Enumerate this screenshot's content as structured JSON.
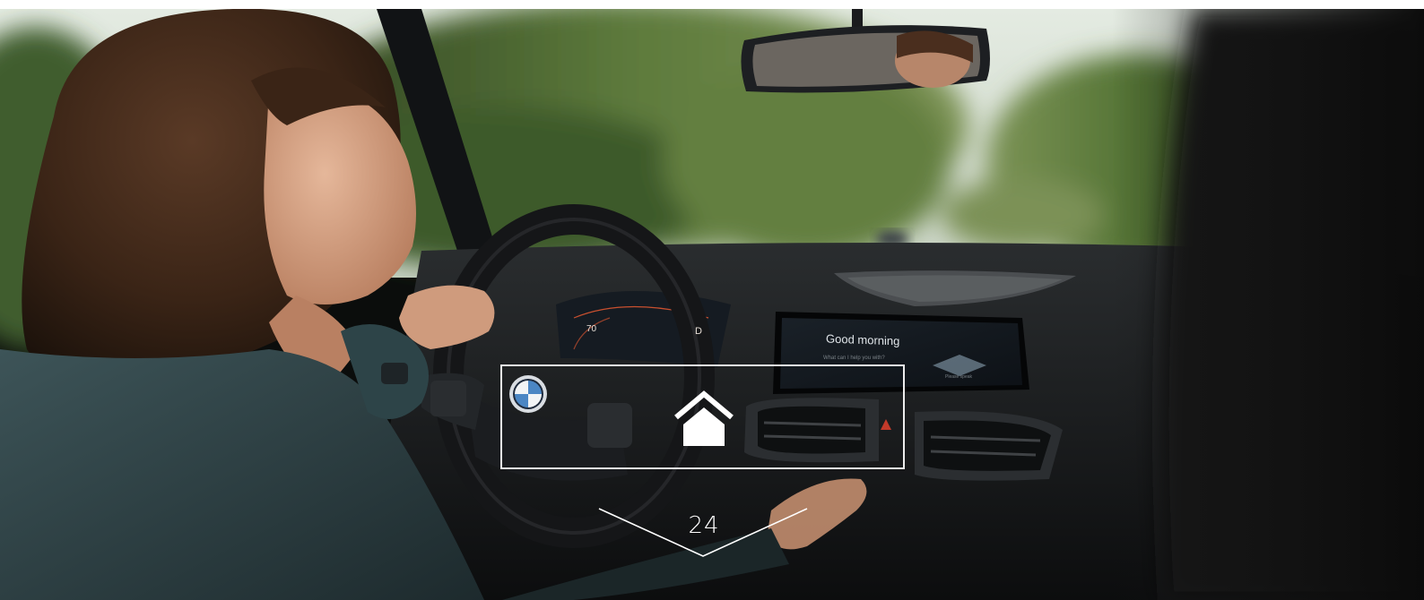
{
  "photo": {
    "description_icon": "car-interior-photo",
    "dashboard_screen": {
      "greeting": "Good morning",
      "subtitle": "What can I help you with?",
      "voice_label": "Please speak"
    },
    "instrument_cluster": {
      "speed": "70",
      "gear": "D"
    }
  },
  "navigation": {
    "home_icon": "home-icon",
    "page_number": "24"
  },
  "colors": {
    "frame": "#ffffff",
    "sky": "#e9efe6",
    "foliage": "#4b6a34",
    "dashboard": "#141617"
  }
}
